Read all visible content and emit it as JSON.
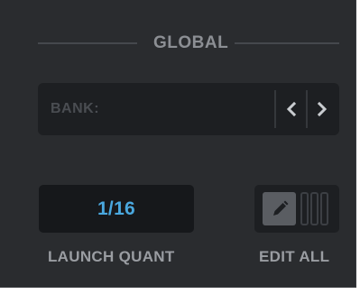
{
  "section": {
    "title": "GLOBAL"
  },
  "bank": {
    "label": "BANK:",
    "prev_icon": "chevron-left-icon",
    "next_icon": "chevron-right-icon"
  },
  "launch_quant": {
    "value": "1/16",
    "label": "LAUNCH QUANT"
  },
  "edit_all": {
    "icon": "pencil-icon",
    "label": "EDIT ALL"
  },
  "colors": {
    "panel_background": "#2a2c2f",
    "field_background": "#1d1f22",
    "accent_value": "#4aa8df",
    "label_text": "#9a9da2"
  }
}
